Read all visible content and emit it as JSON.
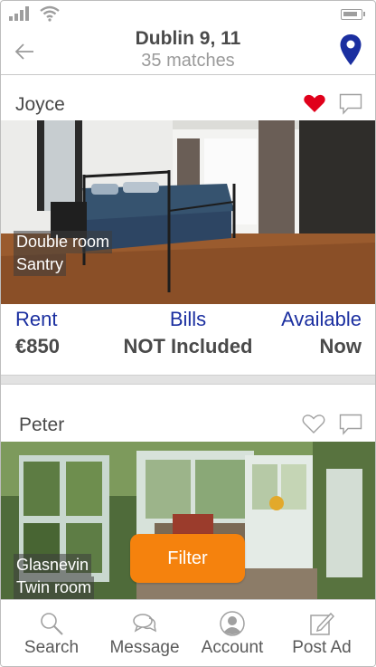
{
  "header": {
    "title": "Dublin 9, 11",
    "subtitle": "35 matches"
  },
  "listings": [
    {
      "name": "Joyce",
      "favorited": true,
      "photo_lines": [
        "Double room",
        "Santry"
      ],
      "rent_label": "Rent",
      "rent_value": "€850",
      "bills_label": "Bills",
      "bills_value": "NOT Included",
      "available_label": "Available",
      "available_value": "Now"
    },
    {
      "name": "Peter",
      "favorited": false,
      "photo_lines": [
        "Glasnevin",
        "Twin room"
      ]
    }
  ],
  "filter_button": "Filter",
  "nav": [
    {
      "label": "Search",
      "icon": "search-icon"
    },
    {
      "label": "Message",
      "icon": "message-icon"
    },
    {
      "label": "Account",
      "icon": "account-icon"
    },
    {
      "label": "Post Ad",
      "icon": "post-ad-icon"
    }
  ],
  "colors": {
    "accent_blue": "#1b2fa0",
    "filter_orange": "#f5820d",
    "heart_red": "#e0001b"
  }
}
